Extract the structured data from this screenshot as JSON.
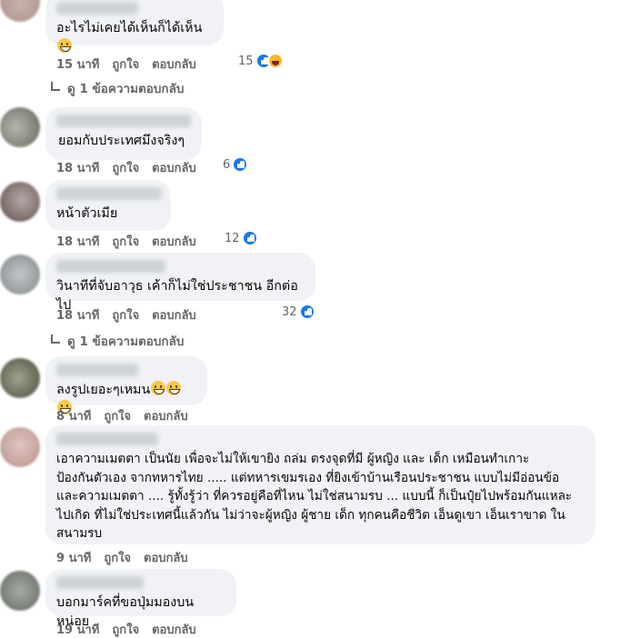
{
  "comments": [
    {
      "text": "อะไรไม่เคยได้เห็นก็ได้เห็น",
      "time": "15 นาที",
      "like": "ถูกใจ",
      "reply": "ตอบกลับ",
      "count": "15",
      "reactions": [
        "like-icon",
        "haha-icon"
      ]
    },
    {
      "text": "ยอมกับประเทศมึงจริงๆ",
      "time": "18 นาที",
      "like": "ถูกใจ",
      "reply": "ตอบกลับ",
      "count": "6",
      "reactions": [
        "like-icon"
      ]
    },
    {
      "text": "หน้าตัวเมีย",
      "time": "18 นาที",
      "like": "ถูกใจ",
      "reply": "ตอบกลับ",
      "count": "12",
      "reactions": [
        "like-icon"
      ]
    },
    {
      "text": "วินาทีที่จับอาวุธ เค้าก็ไม่ใช่ประชาชน อีกต่อไป",
      "time": "18 นาที",
      "like": "ถูกใจ",
      "reply": "ตอบกลับ",
      "count": "32",
      "reactions": [
        "like-icon"
      ]
    },
    {
      "text": "ลงรูปเยอะๆเหมน",
      "time": "8 นาที",
      "like": "ถูกใจ",
      "reply": "ตอบกลับ",
      "count": "",
      "reactions": []
    },
    {
      "text": "เอาความเมตตา เป็นนัย เพื่อจะไม่ให้เขายิง ถล่ม ตรงจุดที่มี ผู้หญิง และ เด็ก เหมือนทำเกาะ\nป้องกันตัวเอง จากทหารไทย ..... แต่ทหารเขมรเอง ที่ยิงเข้าบ้านเรือนประชาชน แบบไม่มีอ่อนข้อ\nและความเมตตา .... รู้ทั้งรู้ว่า ที่ควรอยู่คือที่ไหน ไม่ใช่สนามรบ ... แบบนี้ ก็เป็นปุ๋ยไปพร้อมกันแหละ\nไปเกิด ที่ไม่ใช่ประเทศนี้แล้วกัน ไม่ว่าจะผู้หญิง ผู้ชาย เด็ก ทุกคนคือชีวิต เอ็นดูเขา เอ็นเราขาด ใน\nสนามรบ",
      "time": "9 นาที",
      "like": "ถูกใจ",
      "reply": "ตอบกลับ",
      "count": "",
      "reactions": []
    },
    {
      "text": "บอกมาร์คที่ขอปุ่มมองบนหน่อย",
      "time": "19 นาที",
      "like": "ถูกใจ",
      "reply": "ตอบกลับ",
      "count": "",
      "reactions": []
    }
  ],
  "view_replies": [
    "ดู 1 ข้อความตอบกลับ",
    "ดู 1 ข้อความตอบกลับ"
  ],
  "emoji": {
    "grin": "grinning-face-icon",
    "tongue": "squinting-tongue-face-icon"
  },
  "colors": {
    "bubble": "#f0f2f5",
    "meta": "#65676b",
    "like": "#1877f2"
  }
}
